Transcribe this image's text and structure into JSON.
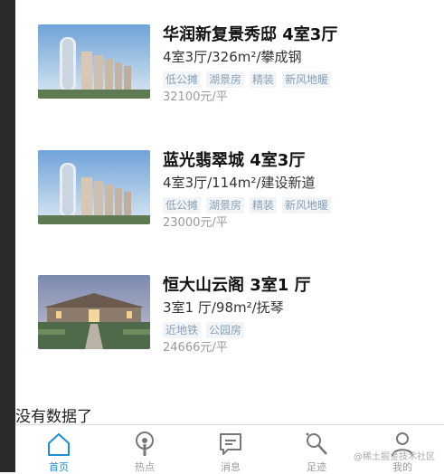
{
  "listings": [
    {
      "title": "华润新复景秀邸 4室3厅",
      "desc": "4室3厅/326m²/攀成钢",
      "tags": [
        "低公摊",
        "湖景房",
        "精装",
        "新风地暖"
      ],
      "price": "32100元/平"
    },
    {
      "title": "蓝光翡翠城 4室3厅",
      "desc": "4室3厅/114m²/建设新道",
      "tags": [
        "低公摊",
        "湖景房",
        "精装",
        "新风地暖"
      ],
      "price": "23000元/平"
    },
    {
      "title": "恒大山云阁 3室1 厅",
      "desc": "3室1 厅/98m²/抚琴",
      "tags": [
        "近地铁",
        "公园房"
      ],
      "price": "24666元/平"
    }
  ],
  "footer_message": "没有数据了",
  "tabbar": {
    "items": [
      {
        "label": "首页",
        "icon": "home-icon",
        "active": true
      },
      {
        "label": "热点",
        "icon": "hot-icon",
        "active": false
      },
      {
        "label": "消息",
        "icon": "message-icon",
        "active": false
      },
      {
        "label": "足迹",
        "icon": "footprint-icon",
        "active": false
      },
      {
        "label": "我的",
        "icon": "user-icon",
        "active": false
      }
    ]
  },
  "watermark": "@稀土掘金技术社区",
  "colors": {
    "accent": "#1e8fd6",
    "tag_text": "#8a9fb5",
    "tag_bg": "#f1f5f8",
    "price": "#9a9a9a"
  }
}
